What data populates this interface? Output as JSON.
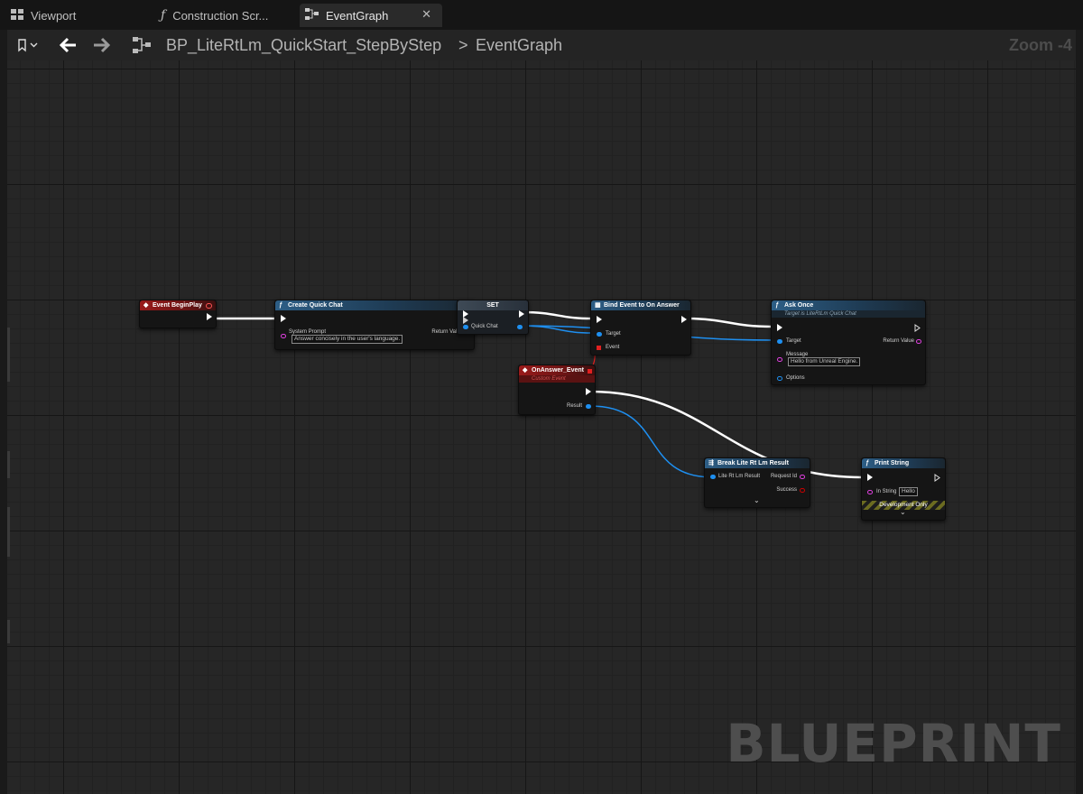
{
  "tabs": [
    {
      "label": "Viewport",
      "icon": "viewport-grid-icon"
    },
    {
      "label": "Construction Scr...",
      "icon": "function-icon"
    },
    {
      "label": "EventGraph",
      "icon": "graph-icon",
      "active": true,
      "close": "✕"
    }
  ],
  "toolbar": {
    "blueprint_name": "BP_LiteRtLm_QuickStart_StepByStep",
    "separator": ">",
    "graph_name": "EventGraph",
    "zoom": "Zoom -4"
  },
  "nodes": {
    "begin_play": {
      "title": "Event BeginPlay"
    },
    "create_quick_chat": {
      "title": "Create Quick Chat",
      "system_prompt_label": "System Prompt",
      "system_prompt_value": "Answer concisely in the user's language.",
      "return_label": "Return Value"
    },
    "set": {
      "title": "SET",
      "var_label": "Quick Chat"
    },
    "bind_event": {
      "title": "Bind Event to On Answer",
      "target_label": "Target",
      "event_label": "Event"
    },
    "ask_once": {
      "title": "Ask Once",
      "subtitle": "Target is LiteRtLm Quick Chat",
      "target_label": "Target",
      "return_label": "Return Value",
      "message_label": "Message",
      "message_value": "Hello from Unreal Engine.",
      "options_label": "Options"
    },
    "on_answer": {
      "title": "OnAnswer_Event",
      "subtitle": "Custom Event",
      "result_label": "Result"
    },
    "break_result": {
      "title": "Break Lite Rt Lm Result",
      "input_label": "Lite Rt Lm Result",
      "request_id_label": "Request Id",
      "success_label": "Success",
      "expand": "⌄"
    },
    "print_string": {
      "title": "Print String",
      "in_string_label": "In String",
      "in_string_value": "Hello",
      "dev_only": "Development Only",
      "expand": "⌄"
    }
  },
  "watermark": "BLUEPRINT",
  "colors": {
    "exec_wire": "#ffffff",
    "object_wire": "#1e8ff0",
    "delegate_wire": "#e02020",
    "string_pin": "#e040e0"
  }
}
